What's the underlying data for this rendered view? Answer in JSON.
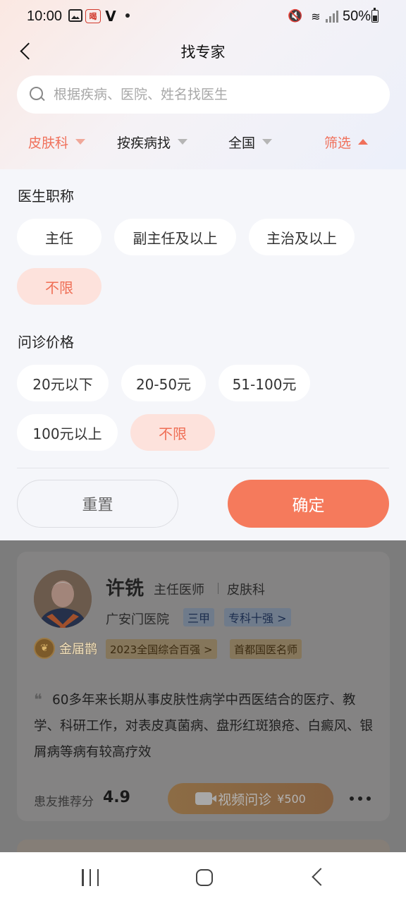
{
  "status_bar": {
    "time": "10:00",
    "app_icon_text": "暍",
    "battery": "50%"
  },
  "header": {
    "title": "找专家"
  },
  "search": {
    "placeholder": "根据疾病、医院、姓名找医生"
  },
  "filter_tabs": [
    {
      "label": "皮肤科"
    },
    {
      "label": "按疾病找"
    },
    {
      "label": "全国"
    },
    {
      "label": "筛选"
    }
  ],
  "filter_panel": {
    "title_section": {
      "heading": "医生职称",
      "options": [
        "主任",
        "副主任及以上",
        "主治及以上",
        "不限"
      ],
      "selected": "不限"
    },
    "price_section": {
      "heading": "问诊价格",
      "options": [
        "20元以下",
        "20-50元",
        "51-100元",
        "100元以上",
        "不限"
      ],
      "selected": "不限"
    },
    "reset_label": "重置",
    "confirm_label": "确定"
  },
  "doctor": {
    "name": "许铣",
    "title": "主任医师",
    "department": "皮肤科",
    "hospital": "广安门医院",
    "hospital_tags": [
      "三甲",
      "专科十强 >"
    ],
    "medal_label": "金届鹊",
    "honor_tags": [
      "2023全国综合百强 >",
      "首都国医名师"
    ],
    "intro": "60多年来长期从事皮肤性病学中西医结合的医疗、教学、科研工作，对表皮真菌病、盘形红斑狼疮、白癜风、银屑病等病有较高疗效",
    "rec_label": "患友推荐分",
    "rec_score": "4.9",
    "video_label": "视频问诊",
    "video_price": "¥500"
  },
  "colors": {
    "accent": "#f57a5c",
    "selected_chip_bg": "#fde2dc",
    "panel_bg": "#f5f6fa"
  }
}
